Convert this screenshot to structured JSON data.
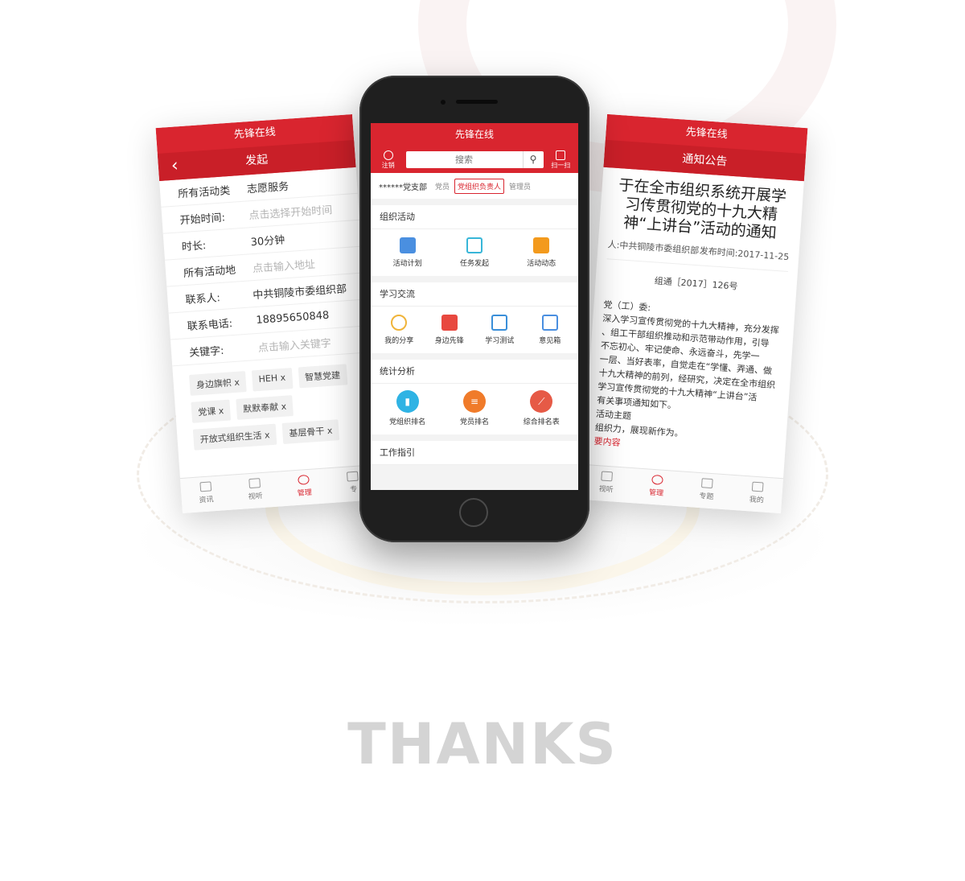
{
  "colors": {
    "brand_red": "#d9252f",
    "thanks_gray": "#d4d4d4"
  },
  "left_screen": {
    "app_title": "先锋在线",
    "page_title": "发起",
    "back_icon": "chevron-left-icon",
    "form": [
      {
        "key": "所有活动类",
        "value": "志愿服务",
        "placeholder": false
      },
      {
        "key": "开始时间:",
        "value": "点击选择开始时间",
        "placeholder": true
      },
      {
        "key": "时长:",
        "value": "30分钟",
        "placeholder": false
      },
      {
        "key": "所有活动地",
        "value": "点击输入地址",
        "placeholder": true
      },
      {
        "key": "联系人:",
        "value": "中共铜陵市委组织部",
        "placeholder": false
      },
      {
        "key": "联系电话:",
        "value": "18895650848",
        "placeholder": false
      },
      {
        "key": "关键字:",
        "value": "点击输入关键字",
        "placeholder": true
      }
    ],
    "tags": [
      "身边旗帜 x",
      "HEH x",
      "智慧党建",
      "党课 x",
      "默默奉献 x",
      "开放式组织生活 x",
      "基层骨干 x"
    ],
    "tabbar": [
      {
        "label": "资讯",
        "icon": "news-icon",
        "active": false
      },
      {
        "label": "视听",
        "icon": "monitor-icon",
        "active": false
      },
      {
        "label": "管理",
        "icon": "manage-icon",
        "active": true
      },
      {
        "label": "专",
        "icon": "topic-icon",
        "active": false
      }
    ]
  },
  "phone": {
    "app_title": "先锋在线",
    "logout_label": "注销",
    "scan_label": "扫一扫",
    "search_placeholder": "搜索",
    "branch_name": "******党支部",
    "roles": [
      {
        "label": "党员",
        "active": false
      },
      {
        "label": "党组织负责人",
        "active": true
      },
      {
        "label": "管理员",
        "active": false
      }
    ],
    "sections": [
      {
        "title": "组织活动",
        "items": [
          {
            "label": "活动计划",
            "icon": "plan-icon",
            "color": "#4a8fe0"
          },
          {
            "label": "任务发起",
            "icon": "edit-icon",
            "color": "#38b6d8"
          },
          {
            "label": "活动动态",
            "icon": "list-icon",
            "color": "#f39a1d"
          }
        ]
      },
      {
        "title": "学习交流",
        "items": [
          {
            "label": "我的分享",
            "icon": "share-icon",
            "color": "#f0b43a"
          },
          {
            "label": "身边先锋",
            "icon": "thumb-up-icon",
            "color": "#e8483f"
          },
          {
            "label": "学习测试",
            "icon": "test-icon",
            "color": "#3a8fd9"
          },
          {
            "label": "意见箱",
            "icon": "mail-icon",
            "color": "#4a8fe0"
          }
        ]
      },
      {
        "title": "统计分析",
        "items": [
          {
            "label": "党组织排名",
            "icon": "bar-chart-icon",
            "color": "#2fb3e4"
          },
          {
            "label": "党员排名",
            "icon": "ranking-list-icon",
            "color": "#f07b2a"
          },
          {
            "label": "综合排名表",
            "icon": "line-chart-icon",
            "color": "#e65a46"
          }
        ]
      },
      {
        "title": "工作指引",
        "items": []
      }
    ]
  },
  "right_screen": {
    "app_title": "先锋在线",
    "page_title": "通知公告",
    "headline": "于在全市组织系统开展学习传贯彻党的十九大精神“上讲台”活动的通知",
    "source": "人:中共铜陵市委组织部",
    "publish_time": "发布时间:2017-11-25",
    "doc_no": "组通［2017］126号",
    "body_lines": [
      "党（工）委:",
      "深入学习宣传贯彻党的十九大精神，充分发挥",
      "、组工干部组织推动和示范带动作用，引导",
      "不忘初心、牢记使命、永远奋斗，先学一",
      "一层、当好表率，自觉走在“学懂、弄通、做",
      "十九大精神的前列，经研究，决定在全市组织",
      "学习宣传贯彻党的十九大精神“上讲台”活",
      "有关事项通知如下。",
      "活动主题",
      "组织力，展现新作为。",
      "要内容"
    ],
    "tabbar": [
      {
        "label": "视听",
        "icon": "monitor-icon",
        "active": false
      },
      {
        "label": "管理",
        "icon": "manage-icon",
        "active": true
      },
      {
        "label": "专题",
        "icon": "topic-icon",
        "active": false
      },
      {
        "label": "我的",
        "icon": "user-icon",
        "active": false
      }
    ]
  },
  "footer": {
    "thanks": "THANKS"
  }
}
